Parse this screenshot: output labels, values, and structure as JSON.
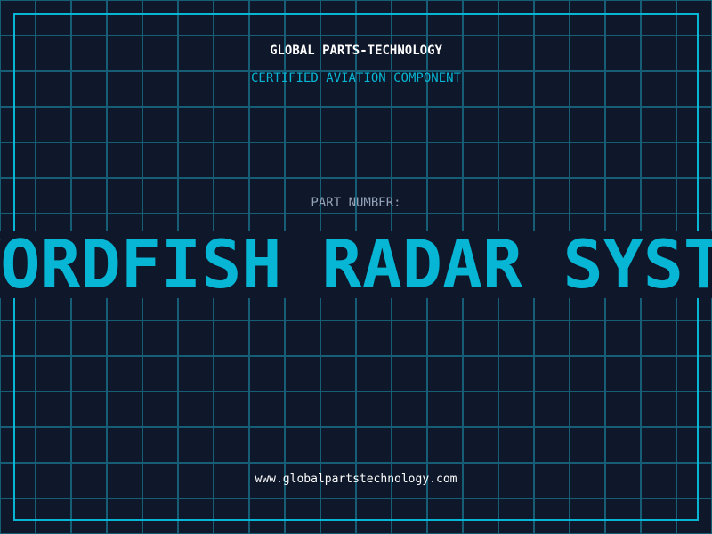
{
  "header": {
    "title": "GLOBAL PARTS-TECHNOLOGY",
    "subtitle": "CERTIFIED AVIATION COMPONENT"
  },
  "part": {
    "label": "PART NUMBER:",
    "value": "SWORDFISH RADAR SYSTEM"
  },
  "footer": {
    "url": "www.globalpartstechnology.com"
  },
  "colors": {
    "background": "#0f172a",
    "grid": "#155e75",
    "accent": "#06b6d4",
    "label": "#94a3b8"
  }
}
